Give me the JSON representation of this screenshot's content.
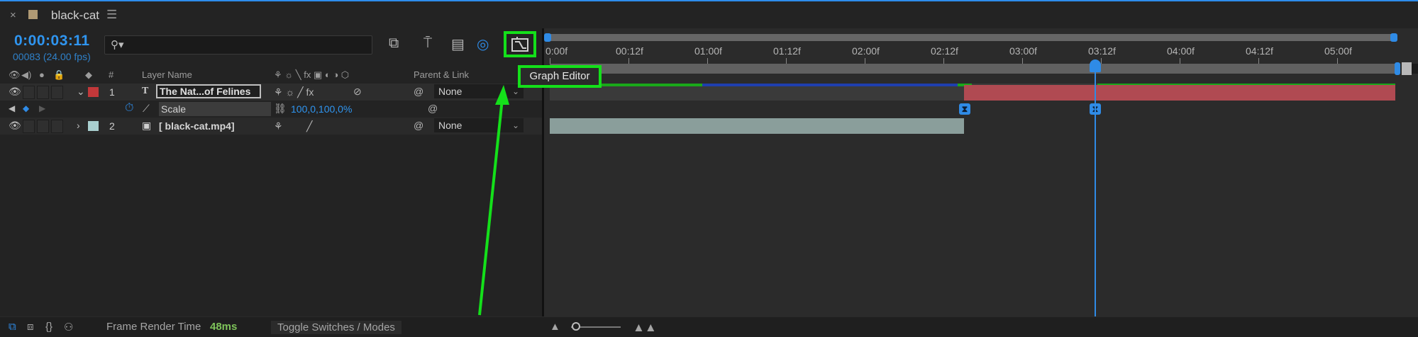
{
  "window": {
    "tab_title": "black-cat"
  },
  "header": {
    "timecode": "0:00:03:11",
    "fps_info": "00083 (24.00 fps)",
    "search_placeholder": "",
    "graph_editor_tooltip": "Graph Editor"
  },
  "columns": {
    "number": "#",
    "layer_name": "Layer Name",
    "parent": "Parent & Link"
  },
  "layers": [
    {
      "index": "1",
      "type_icon": "T",
      "name": "The Nat...of Felines",
      "parent": "None",
      "label_color": "#c2383a"
    },
    {
      "property": "Scale",
      "value": "100,0,100,0%"
    },
    {
      "index": "2",
      "name": "[ black-cat.mp4]",
      "parent": "None",
      "label_color": "#a9cfcf"
    }
  ],
  "ruler": [
    "0:00f",
    "00:12f",
    "01:00f",
    "01:12f",
    "02:00f",
    "02:12f",
    "03:00f",
    "03:12f",
    "04:00f",
    "04:12f",
    "05:00f"
  ],
  "bottom": {
    "frame_render_label": "Frame Render Time",
    "frame_render_value": "48ms",
    "toggle_label": "Toggle Switches / Modes"
  },
  "colors": {
    "accent": "#2f95f0",
    "highlight": "#14e01a",
    "layer1_bar": "#b04a52",
    "layer2_bar": "#8a9e9b"
  }
}
